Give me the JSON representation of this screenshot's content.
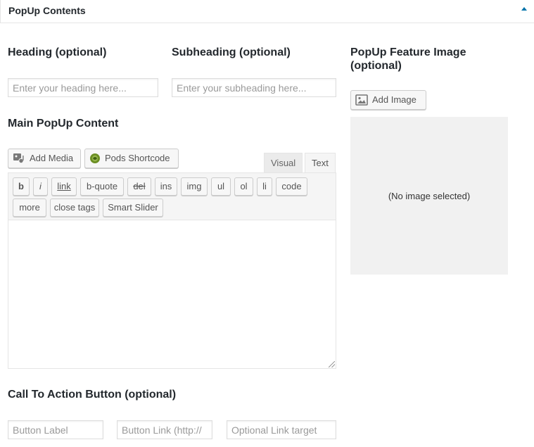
{
  "panel": {
    "title": "PopUp Contents",
    "collapse_icon": "triangle-up-icon"
  },
  "heading_field": {
    "label": "Heading (optional)",
    "placeholder": "Enter your heading here...",
    "value": ""
  },
  "subheading_field": {
    "label": "Subheading (optional)",
    "placeholder": "Enter your subheading here...",
    "value": ""
  },
  "main_content": {
    "label": "Main PopUp Content",
    "add_media_label": "Add Media",
    "add_media_icon": "media-icon",
    "pods_shortcode_label": "Pods Shortcode",
    "pods_icon": "pods-icon",
    "tabs": [
      {
        "label": "Visual",
        "active": false
      },
      {
        "label": "Text",
        "active": true
      }
    ],
    "toolbar_row1": [
      "b",
      "i",
      "link",
      "b-quote",
      "del",
      "ins",
      "img",
      "ul",
      "ol",
      "li",
      "code"
    ],
    "toolbar_row2": [
      "more",
      "close tags",
      "Smart Slider"
    ],
    "body": ""
  },
  "feature_image": {
    "label": "PopUp Feature Image (optional)",
    "add_image_label": "Add Image",
    "add_image_icon": "image-icon",
    "empty_text": "(No image selected)"
  },
  "cta": {
    "label": "Call To Action Button (optional)",
    "button_label_placeholder": "Button Label",
    "button_link_placeholder": "Button Link (http://",
    "link_target_placeholder": "Optional Link target"
  },
  "colors": {
    "accent": "#0073aa",
    "text": "#23282d",
    "border": "#dddddd",
    "preview_bg": "#f1f1f1"
  }
}
